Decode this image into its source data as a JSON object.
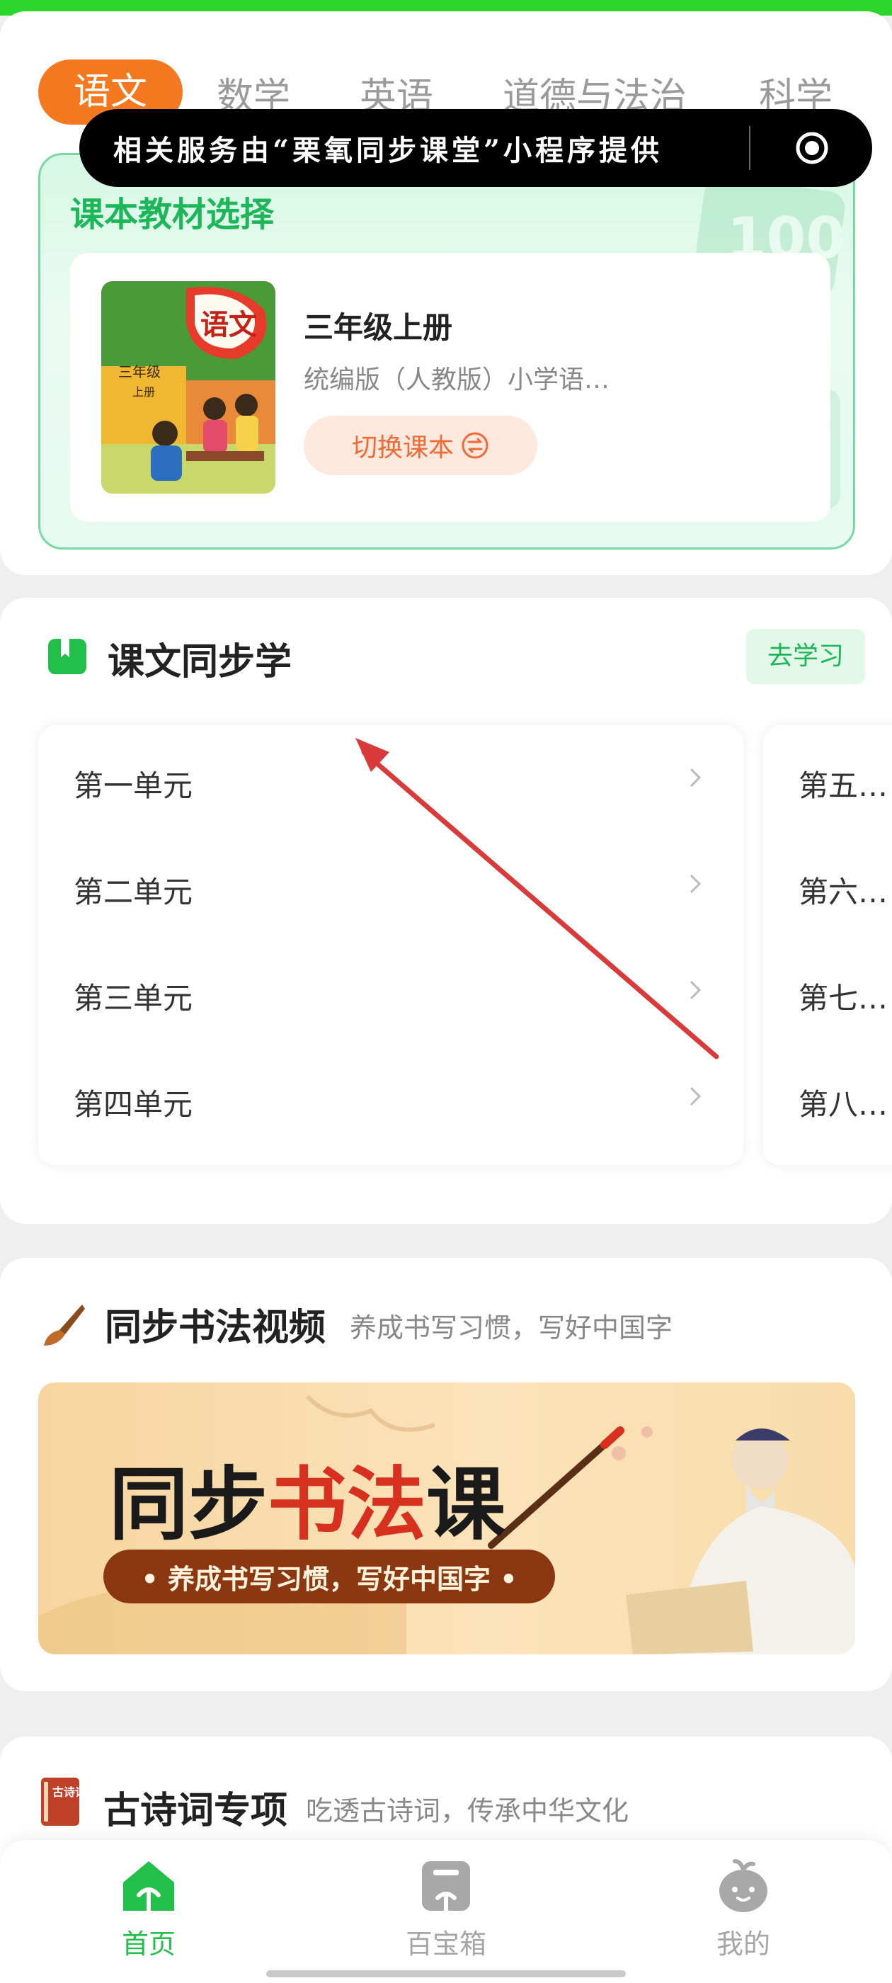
{
  "subjects": {
    "items": [
      "语文",
      "数学",
      "英语",
      "道德与法治",
      "科学"
    ],
    "active_index": 0
  },
  "mini_program_banner": {
    "text": "相关服务由“栗氧同步课堂”小程序提供",
    "close_icon": "target-icon"
  },
  "textbook": {
    "section_title": "课本教材选择",
    "book_grade": "三年级上册",
    "book_edition": "统编版（人教版）小学语…",
    "switch_label": "切换课本",
    "switch_icon": "swap-icon",
    "cover_label": "语文",
    "cover_grade": "三年级",
    "cover_volume": "上册"
  },
  "lessons": {
    "title": "课文同步学",
    "action_label": "去学习",
    "units_col1": [
      "第一单元",
      "第二单元",
      "第三单元",
      "第四单元"
    ],
    "units_col2": [
      "第五…",
      "第六…",
      "第七…",
      "第八…"
    ]
  },
  "calligraphy": {
    "title": "同步书法视频",
    "subtitle": "养成书写习惯，写好中国字",
    "banner_title_black1": "同步",
    "banner_title_red": "书法",
    "banner_title_black2": "课",
    "banner_pill": "• 养成书写习惯，写好中国字 •"
  },
  "poetry": {
    "title": "古诗词专项",
    "subtitle": "吃透古诗词，传承中华文化",
    "icon_label": "古诗词"
  },
  "bottom_nav": {
    "items": [
      {
        "label": "首页",
        "icon": "home-icon",
        "active": true
      },
      {
        "label": "百宝箱",
        "icon": "treasure-box-icon",
        "active": false
      },
      {
        "label": "我的",
        "icon": "profile-icon",
        "active": false
      }
    ]
  },
  "colors": {
    "accent_green": "#1db658",
    "active_tab_orange": "#f4781f",
    "switch_orange": "#f06a35",
    "annotation_red": "#d93a3a"
  }
}
